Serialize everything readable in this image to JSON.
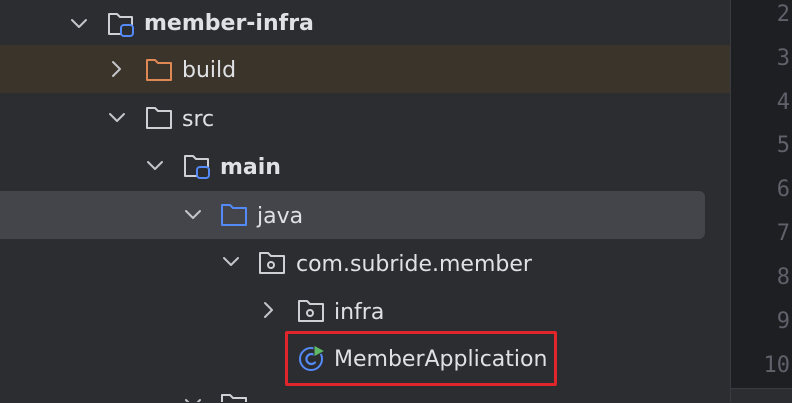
{
  "tree": {
    "items": [
      {
        "label": "member-infra",
        "icon": "module-folder-icon",
        "expanded": true
      },
      {
        "label": "build",
        "icon": "excluded-folder-icon",
        "expanded": false
      },
      {
        "label": "src",
        "icon": "folder-icon",
        "expanded": true
      },
      {
        "label": "main",
        "icon": "source-root-folder-icon",
        "expanded": true
      },
      {
        "label": "java",
        "icon": "source-folder-icon",
        "expanded": true
      },
      {
        "label": "com.subride.member",
        "icon": "package-icon",
        "expanded": true
      },
      {
        "label": "infra",
        "icon": "package-icon",
        "expanded": false
      },
      {
        "label": "MemberApplication",
        "icon": "spring-boot-class-icon"
      }
    ]
  },
  "gutter": {
    "line_numbers": [
      "2",
      "3",
      "4",
      "5",
      "6",
      "7",
      "8",
      "9",
      "10"
    ]
  },
  "colors": {
    "tree_background": "#2b2d30",
    "editor_background": "#1e1f22",
    "selection": "#43454a",
    "excluded_row": "#3b342b",
    "highlight_box": "#e0262b",
    "folder_blue": "#548af7",
    "folder_orange": "#e08855"
  }
}
